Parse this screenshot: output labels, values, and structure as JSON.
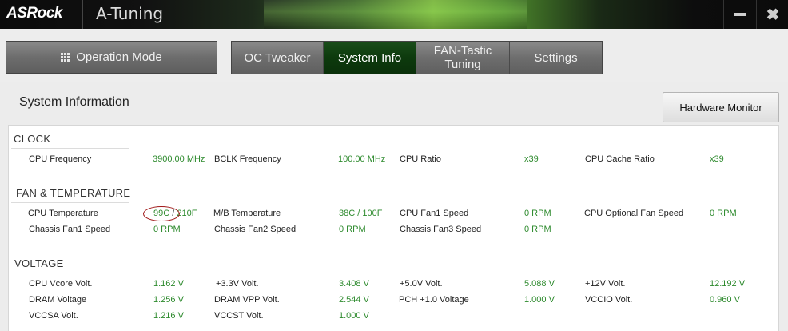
{
  "window": {
    "brand": "ASRock",
    "title": "A-Tuning",
    "minimize_glyph": "",
    "close_glyph": "✖"
  },
  "nav": {
    "operation_mode": "Operation Mode",
    "tabs": [
      {
        "label": "OC Tweaker",
        "active": false
      },
      {
        "label": "System Info",
        "active": true
      },
      {
        "label": "FAN-Tastic\nTuning",
        "active": false
      },
      {
        "label": "Settings",
        "active": false
      }
    ]
  },
  "page": {
    "title": "System Information",
    "hardware_monitor_button": "Hardware Monitor"
  },
  "groups": {
    "clock": {
      "title": "CLOCK",
      "rows": [
        [
          {
            "label": "CPU Frequency",
            "value": "3900.00 MHz"
          },
          {
            "label": "BCLK Frequency",
            "value": "100.00 MHz"
          },
          {
            "label": "CPU Ratio",
            "value": "x39"
          },
          {
            "label": "CPU Cache Ratio",
            "value": "x39"
          }
        ]
      ]
    },
    "fan_temp": {
      "title": "FAN & TEMPERATURE",
      "cpu_temp": {
        "label": "CPU Temperature",
        "value_c": "99C",
        "sep": " / ",
        "value_f": "210F"
      },
      "rows": [
        [
          {
            "label": "M/B Temperature",
            "value": "38C / 100F"
          },
          {
            "label": "CPU Fan1 Speed",
            "value": "0 RPM"
          },
          {
            "label": "CPU Optional Fan Speed",
            "value": "0 RPM"
          }
        ],
        [
          {
            "label": "Chassis Fan1 Speed",
            "value": "0 RPM"
          },
          {
            "label": "Chassis Fan2 Speed",
            "value": "0 RPM"
          },
          {
            "label": "Chassis Fan3 Speed",
            "value": "0 RPM"
          }
        ]
      ]
    },
    "voltage": {
      "title": "VOLTAGE",
      "rows": [
        [
          {
            "label": "CPU Vcore Volt.",
            "value": "1.162 V"
          },
          {
            "label": "+3.3V Volt.",
            "value": "3.408 V"
          },
          {
            "label": "+5.0V Volt.",
            "value": "5.088 V"
          },
          {
            "label": "+12V Volt.",
            "value": "12.192 V"
          }
        ],
        [
          {
            "label": "DRAM Voltage",
            "value": "1.256 V"
          },
          {
            "label": "DRAM VPP Volt.",
            "value": "2.544 V"
          },
          {
            "label": "PCH +1.0 Voltage",
            "value": "1.000 V"
          },
          {
            "label": "VCCIO Volt.",
            "value": "0.960 V"
          }
        ],
        [
          {
            "label": "VCCSA Volt.",
            "value": "1.216 V"
          },
          {
            "label": "VCCST Volt.",
            "value": "1.000 V"
          }
        ]
      ]
    }
  },
  "colors": {
    "value_green": "#2d8a2d",
    "active_tab": "#0d3a0d",
    "annotation_red": "#a01818"
  }
}
